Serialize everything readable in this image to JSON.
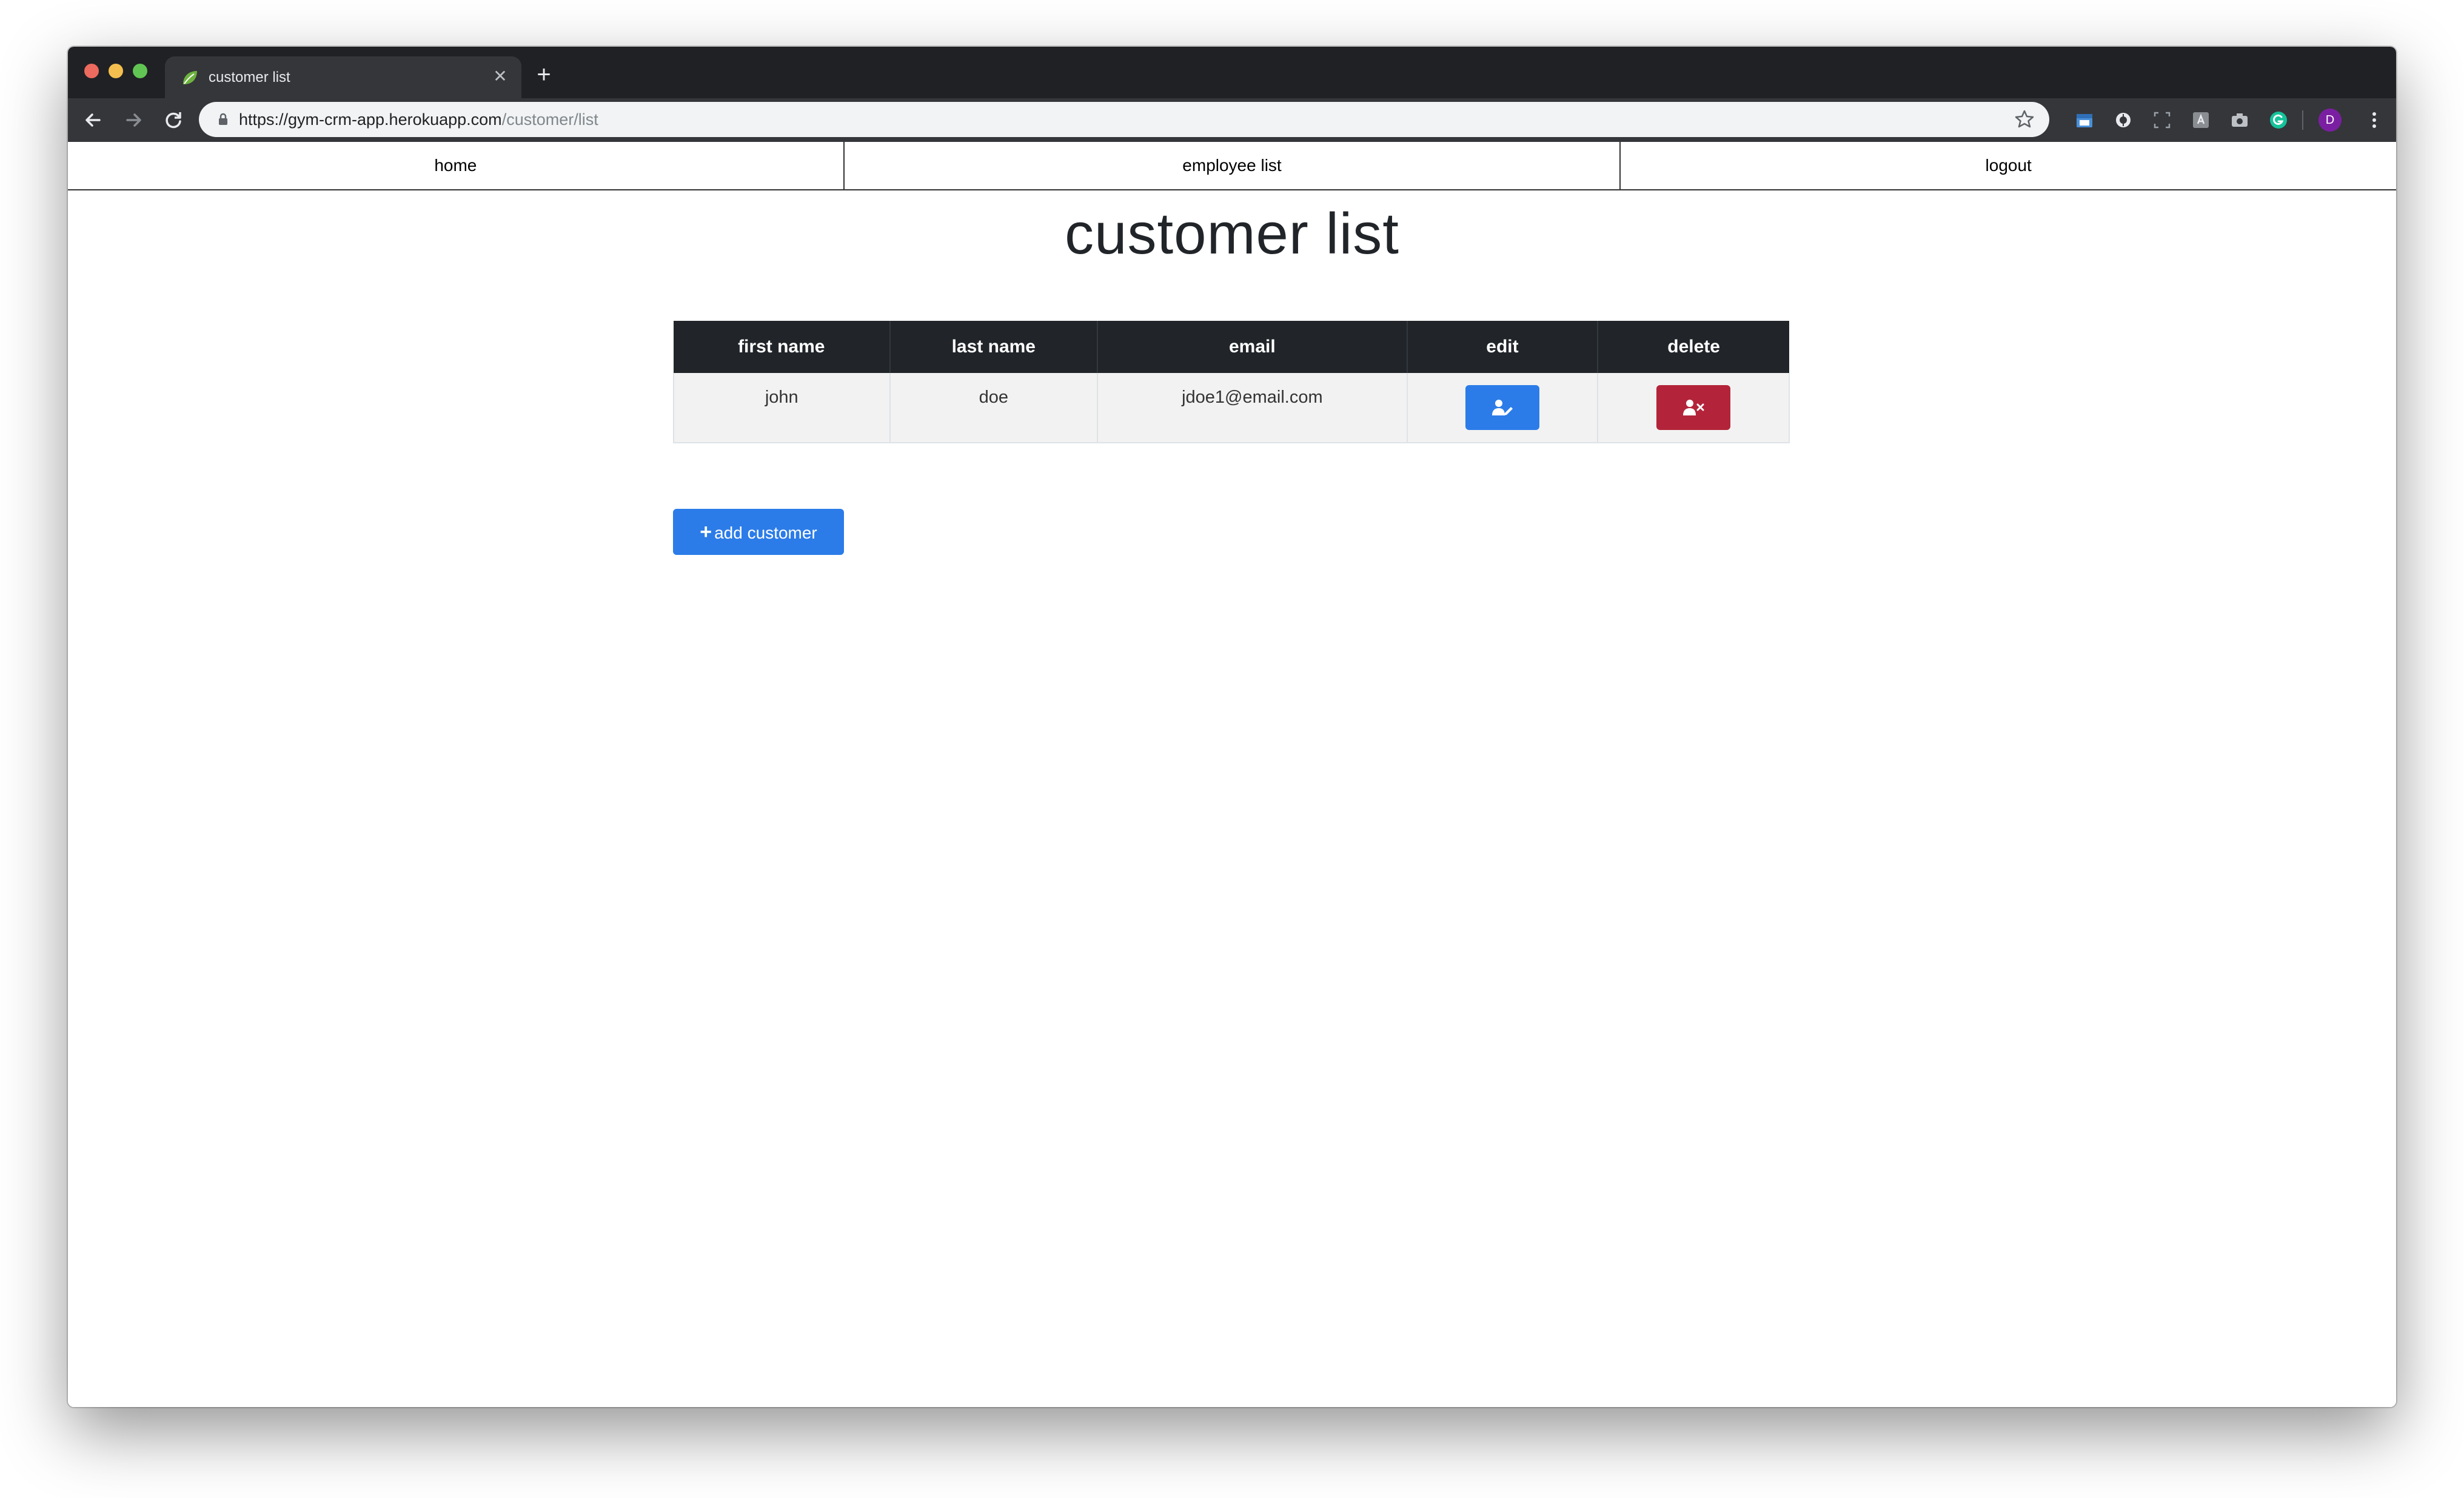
{
  "browser": {
    "tab": {
      "title": "customer list",
      "favicon": "spring-leaf-icon",
      "close_glyph": "✕"
    },
    "new_tab_glyph": "+",
    "url": {
      "host": "https://gym-crm-app.herokuapp.com",
      "path": "/customer/list"
    },
    "profile_initial": "D"
  },
  "nav": {
    "items": [
      "home",
      "employee list",
      "logout"
    ]
  },
  "page": {
    "title": "customer list"
  },
  "table": {
    "headers": [
      "first name",
      "last name",
      "email",
      "edit",
      "delete"
    ],
    "rows": [
      {
        "first_name": "john",
        "last_name": "doe",
        "email": "jdoe1@email.com"
      }
    ]
  },
  "actions": {
    "add_glyph": "+",
    "add_label": "add customer"
  },
  "colors": {
    "primary": "#2b7ce8",
    "danger": "#b3243a",
    "table_header": "#212529",
    "table_row": "#f2f2f2"
  }
}
